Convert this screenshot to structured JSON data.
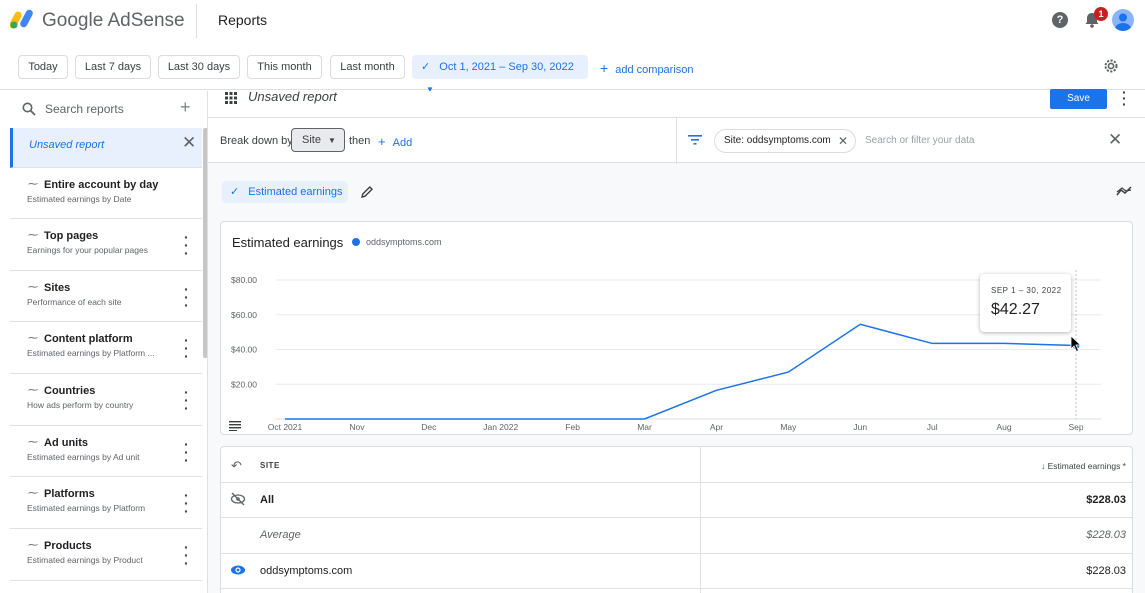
{
  "app": {
    "brand": "Google AdSense",
    "page_title": "Reports",
    "notification_count": "1"
  },
  "date_toolbar": {
    "chips": [
      "Today",
      "Last 7 days",
      "Last 30 days",
      "This month",
      "Last month"
    ],
    "active_range": "Oct 1, 2021 – Sep 30, 2022",
    "add_comparison": "add comparison"
  },
  "sidebar": {
    "search_placeholder": "Search reports",
    "current": "Unsaved report",
    "items": [
      {
        "title": "Entire account by day",
        "subtitle": "Estimated earnings by Date"
      },
      {
        "title": "Top pages",
        "subtitle": "Earnings for your popular pages"
      },
      {
        "title": "Sites",
        "subtitle": "Performance of each site"
      },
      {
        "title": "Content platform",
        "subtitle": "Estimated earnings by Platform ..."
      },
      {
        "title": "Countries",
        "subtitle": "How ads perform by country"
      },
      {
        "title": "Ad units",
        "subtitle": "Estimated earnings by Ad unit"
      },
      {
        "title": "Platforms",
        "subtitle": "Estimated earnings by Platform"
      },
      {
        "title": "Products",
        "subtitle": "Estimated earnings by Product"
      }
    ]
  },
  "report": {
    "title": "Unsaved report",
    "save_label": "Save",
    "break_down_label": "Break down by",
    "break_down_value": "Site",
    "then_label": "then",
    "add_label": "Add",
    "filter_chip": "Site: oddsymptoms.com",
    "filter_placeholder": "Search or filter your data",
    "metric_chip": "Estimated earnings"
  },
  "chart_data": {
    "type": "line",
    "title": "Estimated earnings",
    "series": [
      {
        "name": "oddsymptoms.com",
        "color": "#1a73e8",
        "values": [
          0,
          0,
          0,
          0,
          0,
          0,
          16.5,
          27,
          54.5,
          43.5,
          43.5,
          42.27
        ]
      }
    ],
    "categories": [
      "Oct 2021",
      "Nov",
      "Dec",
      "Jan 2022",
      "Feb",
      "Mar",
      "Apr",
      "May",
      "Jun",
      "Jul",
      "Aug",
      "Sep"
    ],
    "ylim": [
      0,
      80
    ],
    "yticks": [
      "$80.00",
      "$60.00",
      "$40.00",
      "$20.00"
    ],
    "tooltip": {
      "label": "SEP 1 – 30, 2022",
      "value": "$42.27"
    },
    "grid": true
  },
  "table": {
    "col_site": "SITE",
    "col_earnings": "↓ Estimated earnings *",
    "rows": [
      {
        "label": "All",
        "value": "$228.03"
      },
      {
        "label": "Average",
        "value": "$228.03"
      },
      {
        "label": "oddsymptoms.com",
        "value": "$228.03"
      }
    ]
  }
}
